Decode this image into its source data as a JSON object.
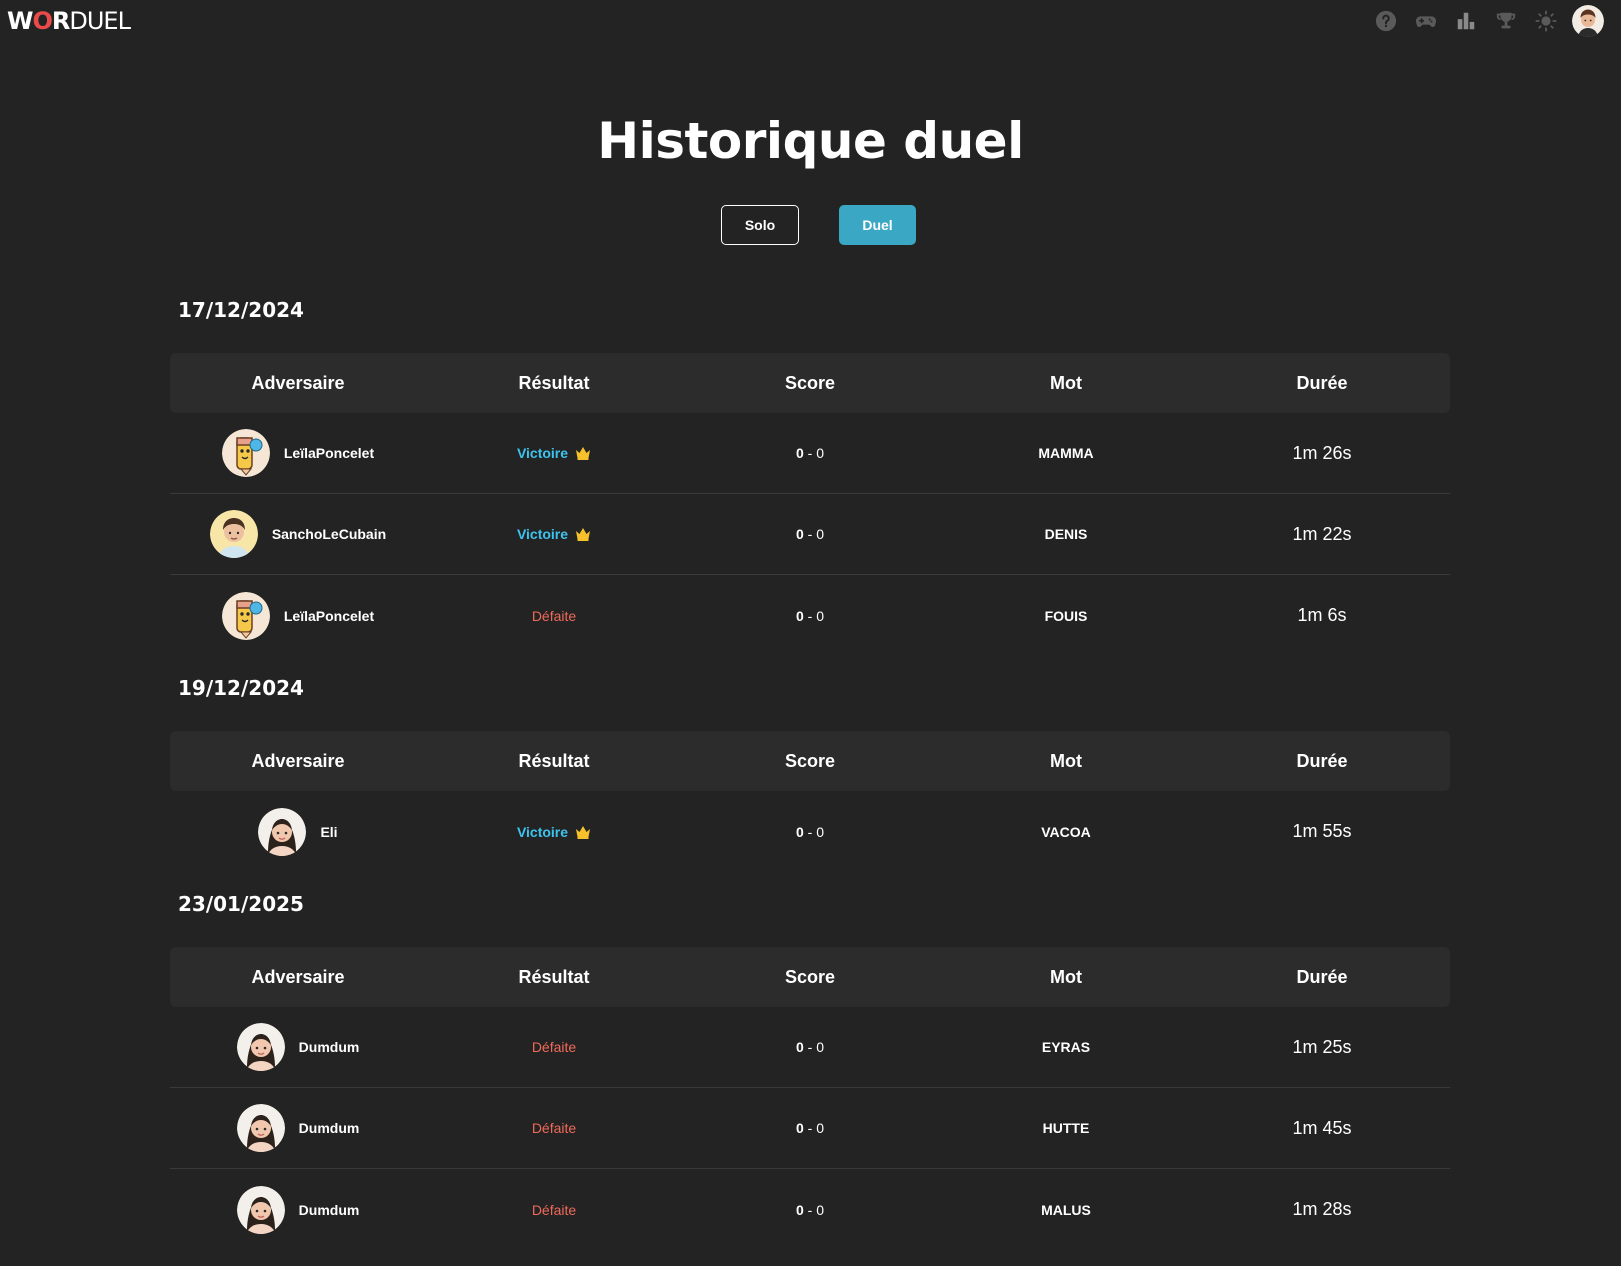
{
  "app": {
    "logo_w": "W",
    "logo_o": "O",
    "logo_r": "R",
    "logo_duel": "DUEL"
  },
  "nav_icons": [
    "help-icon",
    "gamepad-icon",
    "stats-icon",
    "trophy-icon",
    "brightness-icon",
    "user-avatar"
  ],
  "page": {
    "title": "Historique duel",
    "modes": {
      "solo": "Solo",
      "duel": "Duel",
      "active": "Duel"
    }
  },
  "colors": {
    "background": "#232323",
    "accent": "#3aa7c4",
    "win": "#3cc4ef",
    "loss": "#ef6a5a",
    "crown": "#f6c12b",
    "logo_o": "#e94b4b"
  },
  "columns": [
    "Adversaire",
    "Résultat",
    "Score",
    "Mot",
    "Durée"
  ],
  "sections": [
    {
      "date": "17/12/2024",
      "rows": [
        {
          "opponent": "LeïlaPoncelet",
          "avatar": "pencil-avatar",
          "result": "Victoire",
          "win": true,
          "score_a": "0",
          "score_sep": " - ",
          "score_b": "0",
          "word": "MAMMA",
          "duration": "1m 26s"
        },
        {
          "opponent": "SanchoLeCubain",
          "avatar": "boy-avatar",
          "result": "Victoire",
          "win": true,
          "score_a": "0",
          "score_sep": " - ",
          "score_b": "0",
          "word": "DENIS",
          "duration": "1m 22s"
        },
        {
          "opponent": "LeïlaPoncelet",
          "avatar": "pencil-avatar",
          "result": "Défaite",
          "win": false,
          "score_a": "0",
          "score_sep": " - ",
          "score_b": "0",
          "word": "FOUIS",
          "duration": "1m 6s"
        }
      ]
    },
    {
      "date": "19/12/2024",
      "rows": [
        {
          "opponent": "Eli",
          "avatar": "girl-avatar",
          "result": "Victoire",
          "win": true,
          "score_a": "0",
          "score_sep": " - ",
          "score_b": "0",
          "word": "VACOA",
          "duration": "1m 55s"
        }
      ]
    },
    {
      "date": "23/01/2025",
      "rows": [
        {
          "opponent": "Dumdum",
          "avatar": "girl-avatar",
          "result": "Défaite",
          "win": false,
          "score_a": "0",
          "score_sep": " - ",
          "score_b": "0",
          "word": "EYRAS",
          "duration": "1m 25s"
        },
        {
          "opponent": "Dumdum",
          "avatar": "girl-avatar",
          "result": "Défaite",
          "win": false,
          "score_a": "0",
          "score_sep": " - ",
          "score_b": "0",
          "word": "HUTTE",
          "duration": "1m 45s"
        },
        {
          "opponent": "Dumdum",
          "avatar": "girl-avatar",
          "result": "Défaite",
          "win": false,
          "score_a": "0",
          "score_sep": " - ",
          "score_b": "0",
          "word": "MALUS",
          "duration": "1m 28s"
        }
      ]
    }
  ]
}
